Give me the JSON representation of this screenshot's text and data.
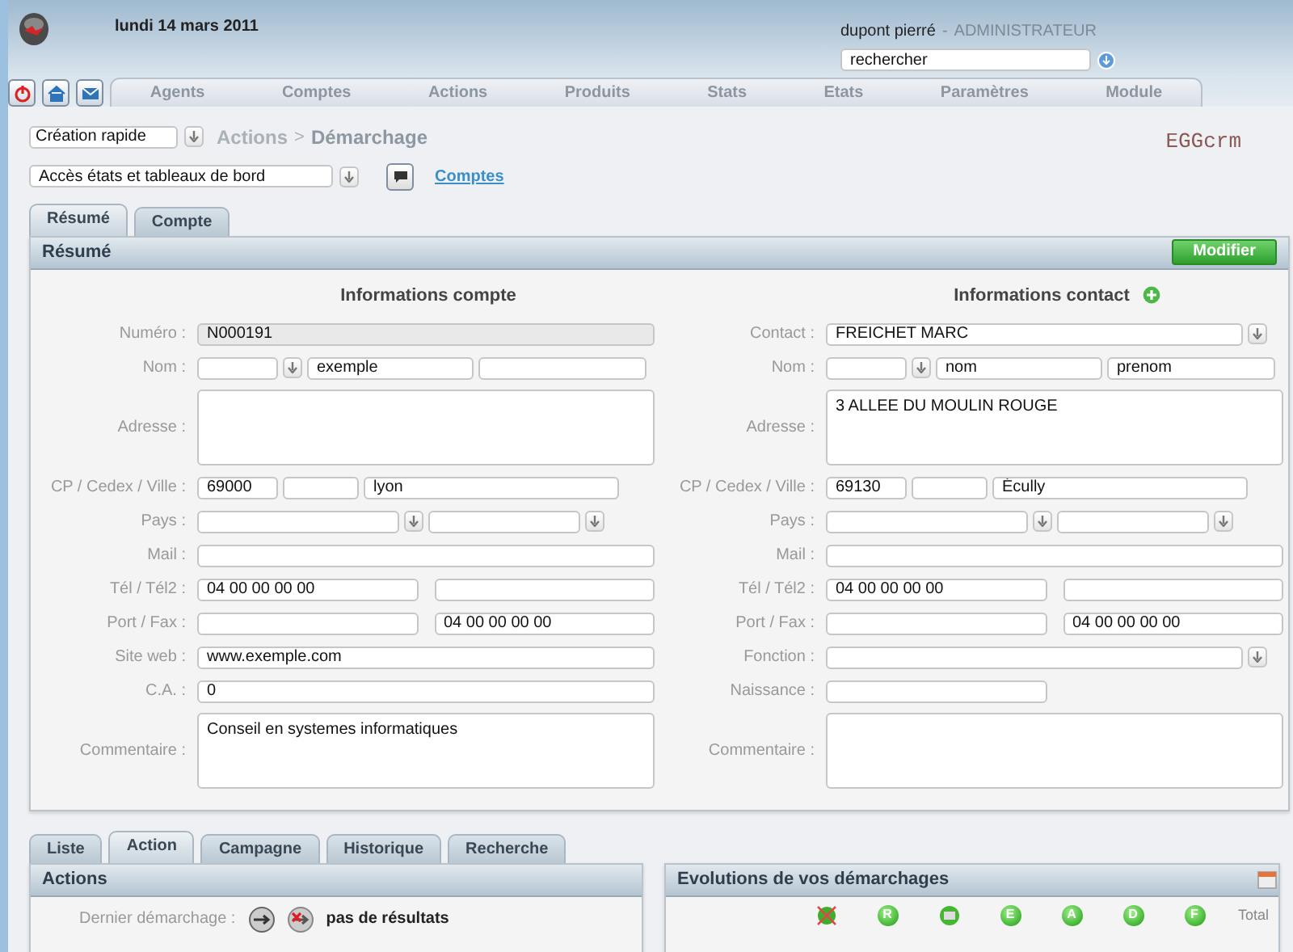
{
  "header": {
    "date": "lundi 14 mars 2011",
    "user": "dupont pierré",
    "separator": "-",
    "role": "ADMINISTRATEUR",
    "search": {
      "value": "rechercher"
    }
  },
  "nav": [
    "Agents",
    "Comptes",
    "Actions",
    "Produits",
    "Stats",
    "Etats",
    "Paramètres",
    "Module"
  ],
  "quick_create": {
    "value": "Création rapide"
  },
  "breadcrumb": {
    "parent": "Actions",
    "separator": ">",
    "current": "Démarchage"
  },
  "brand": "EGGcrm",
  "report_select": {
    "value": "Accès états et tableaux de bord"
  },
  "link": "Comptes",
  "tabs": [
    {
      "label": "Résumé",
      "selected": true
    },
    {
      "label": "Compte",
      "selected": false
    }
  ],
  "panel": {
    "title": "Résumé",
    "button": "Modifier",
    "account": {
      "title": "Informations compte",
      "rows": [
        {
          "label": "Numéro :",
          "kind": "full",
          "fields": [
            {
              "kind": "readonly",
              "value": "N000191"
            }
          ]
        },
        {
          "label": "Nom :",
          "kind": "title_pair",
          "fields": [
            {
              "kind": "select"
            },
            {
              "kind": "text",
              "value": "exemple"
            },
            {
              "kind": "text"
            }
          ]
        },
        {
          "label": "Adresse :",
          "kind": "full",
          "fields": [
            {
              "kind": "area"
            }
          ]
        },
        {
          "label": "CP / Cedex / Ville :",
          "kind": "city",
          "fields": [
            {
              "kind": "text",
              "value": "69000"
            },
            {
              "kind": "text"
            },
            {
              "kind": "text",
              "value": "lyon"
            }
          ]
        },
        {
          "label": "Pays :",
          "kind": "country",
          "fields": [
            {
              "kind": "select"
            },
            {
              "kind": "select"
            }
          ]
        },
        {
          "label": "Mail :",
          "kind": "full",
          "fields": [
            {
              "kind": "text"
            }
          ]
        },
        {
          "label": "Tél / Tél2 :",
          "kind": "pair",
          "fields": [
            {
              "kind": "text",
              "value": "04 00 00 00 00"
            },
            {
              "kind": "text"
            }
          ]
        },
        {
          "label": "Port / Fax :",
          "kind": "pair",
          "fields": [
            {
              "kind": "text"
            },
            {
              "kind": "text",
              "value": "04 00 00 00 00"
            }
          ]
        },
        {
          "label": "Site web :",
          "kind": "full",
          "fields": [
            {
              "kind": "text",
              "value": "www.exemple.com"
            }
          ]
        },
        {
          "label": "C.A. :",
          "kind": "full",
          "fields": [
            {
              "kind": "text",
              "value": "0"
            }
          ]
        },
        {
          "label": "Commentaire :",
          "kind": "full",
          "fields": [
            {
              "kind": "area",
              "value": "Conseil en systemes informatiques"
            }
          ]
        }
      ]
    },
    "contact": {
      "title": "Informations contact",
      "rows": [
        {
          "label": "Contact :",
          "kind": "full",
          "fields": [
            {
              "kind": "select",
              "value": "FREICHET MARC"
            }
          ]
        },
        {
          "label": "Nom :",
          "kind": "title_pair",
          "fields": [
            {
              "kind": "select"
            },
            {
              "kind": "text",
              "value": "nom"
            },
            {
              "kind": "text",
              "value": "prenom"
            }
          ]
        },
        {
          "label": "Adresse :",
          "kind": "full",
          "fields": [
            {
              "kind": "area",
              "value": "3 ALLEE DU MOULIN ROUGE"
            }
          ]
        },
        {
          "label": "CP / Cedex / Ville :",
          "kind": "city",
          "fields": [
            {
              "kind": "text",
              "value": "69130"
            },
            {
              "kind": "text"
            },
            {
              "kind": "text",
              "value": "Écully"
            }
          ]
        },
        {
          "label": "Pays :",
          "kind": "country",
          "fields": [
            {
              "kind": "select"
            },
            {
              "kind": "select"
            }
          ]
        },
        {
          "label": "Mail :",
          "kind": "full",
          "fields": [
            {
              "kind": "text"
            }
          ]
        },
        {
          "label": "Tél / Tél2 :",
          "kind": "pair",
          "fields": [
            {
              "kind": "text",
              "value": "04 00 00 00 00"
            },
            {
              "kind": "text"
            }
          ]
        },
        {
          "label": "Port / Fax :",
          "kind": "pair",
          "fields": [
            {
              "kind": "text"
            },
            {
              "kind": "text",
              "value": "04 00 00 00 00"
            }
          ]
        },
        {
          "label": "Fonction :",
          "kind": "full",
          "fields": [
            {
              "kind": "select"
            }
          ]
        },
        {
          "label": "Naissance :",
          "kind": "half",
          "fields": [
            {
              "kind": "text"
            }
          ]
        },
        {
          "label": "Commentaire :",
          "kind": "full",
          "fields": [
            {
              "kind": "area"
            }
          ]
        }
      ]
    }
  },
  "bottom_tabs": [
    {
      "label": "Liste",
      "selected": false
    },
    {
      "label": "Action",
      "selected": true
    },
    {
      "label": "Campagne",
      "selected": false
    },
    {
      "label": "Historique",
      "selected": false
    },
    {
      "label": "Recherche",
      "selected": false
    }
  ],
  "actions": {
    "title": "Actions",
    "label": "Dernier démarchage :",
    "result": "pas de résultats"
  },
  "evolution": {
    "title": "Evolutions de vos démarchages",
    "columns": [
      {
        "kind": "cancel"
      },
      {
        "kind": "letter",
        "label": "R"
      },
      {
        "kind": "print"
      },
      {
        "kind": "letter",
        "label": "E"
      },
      {
        "kind": "letter",
        "label": "A"
      },
      {
        "kind": "letter",
        "label": "D"
      },
      {
        "kind": "letter",
        "label": "F"
      }
    ],
    "total": "Total"
  }
}
